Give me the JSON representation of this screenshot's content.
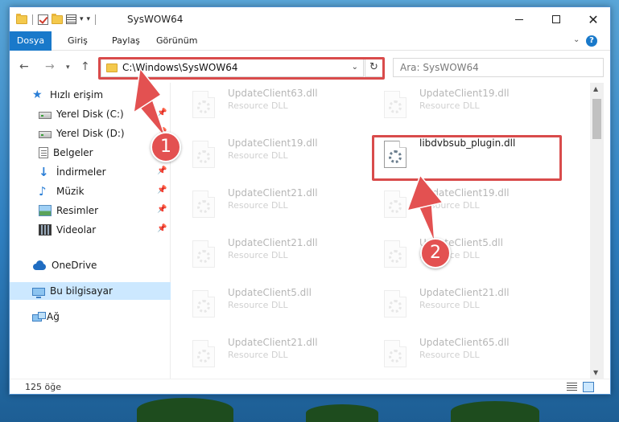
{
  "window": {
    "title": "SysWOW64",
    "controls": {
      "close": "✕"
    }
  },
  "ribbon": {
    "tabs": [
      "Dosya",
      "Giriş",
      "Paylaş",
      "Görünüm"
    ]
  },
  "navigation": {
    "address": "C:\\Windows\\SysWOW64",
    "search_placeholder": "Ara: SysWOW64"
  },
  "sidebar": {
    "items": [
      {
        "label": "Hızlı erişim",
        "icon": "star-icon",
        "pinned": false
      },
      {
        "label": "Yerel Disk (C:)",
        "icon": "drive-icon",
        "pinned": true
      },
      {
        "label": "Yerel Disk (D:)",
        "icon": "drive-icon",
        "pinned": true
      },
      {
        "label": "Belgeler",
        "icon": "documents-icon",
        "pinned": true
      },
      {
        "label": "İndirmeler",
        "icon": "downloads-icon",
        "pinned": true
      },
      {
        "label": "Müzik",
        "icon": "music-icon",
        "pinned": true
      },
      {
        "label": "Resimler",
        "icon": "pictures-icon",
        "pinned": true
      },
      {
        "label": "Videolar",
        "icon": "videos-icon",
        "pinned": true
      },
      {
        "label": "OneDrive",
        "icon": "onedrive-icon",
        "pinned": false
      },
      {
        "label": "Bu bilgisayar",
        "icon": "this-pc-icon",
        "pinned": false,
        "selected": true
      },
      {
        "label": "Ağ",
        "icon": "network-icon",
        "pinned": false
      }
    ]
  },
  "files": {
    "left_column": [
      {
        "name": "UpdateClient63.dll",
        "type": "Resource DLL"
      },
      {
        "name": "UpdateClient19.dll",
        "type": "Resource DLL"
      },
      {
        "name": "UpdateClient21.dll",
        "type": "Resource DLL"
      },
      {
        "name": "UpdateClient21.dll",
        "type": "Resource DLL"
      },
      {
        "name": "UpdateClient5.dll",
        "type": "Resource DLL"
      },
      {
        "name": "UpdateClient21.dll",
        "type": "Resource DLL"
      }
    ],
    "right_column": [
      {
        "name": "UpdateClient19.dll",
        "type": "Resource DLL"
      },
      {
        "name": "libdvbsub_plugin.dll",
        "type": ""
      },
      {
        "name": "UpdateClient19.dll",
        "type": "Resource DLL"
      },
      {
        "name": "UpdateClient5.dll",
        "type": "Resource DLL"
      },
      {
        "name": "UpdateClient21.dll",
        "type": "Resource DLL"
      },
      {
        "name": "UpdateClient65.dll",
        "type": "Resource DLL"
      }
    ],
    "highlighted": "libdvbsub_plugin.dll"
  },
  "status": {
    "count": "125 öğe"
  },
  "annotations": {
    "step1": "1",
    "step2": "2",
    "color": "#e35151"
  }
}
